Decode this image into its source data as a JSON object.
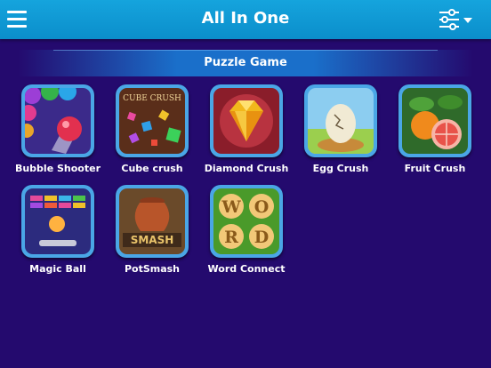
{
  "header": {
    "title": "All In One",
    "menu_icon": "hamburger-menu-icon",
    "filter_icon": "sliders-filter-icon"
  },
  "section": {
    "title": "Puzzle Game"
  },
  "games": [
    {
      "label": "Bubble Shooter"
    },
    {
      "label": "Cube crush",
      "icon_text": "CUBE CRUSH"
    },
    {
      "label": "Diamond Crush"
    },
    {
      "label": "Egg Crush"
    },
    {
      "label": "Fruit Crush"
    },
    {
      "label": "Magic Ball"
    },
    {
      "label": "PotSmash",
      "icon_text": "SMASH"
    },
    {
      "label": "Word Connect",
      "icon_letters": [
        "W",
        "O",
        "R",
        "D"
      ]
    }
  ],
  "colors": {
    "header": "#0b8ecb",
    "background": "#240a6e",
    "tile_frame": "#4aa6e6"
  }
}
